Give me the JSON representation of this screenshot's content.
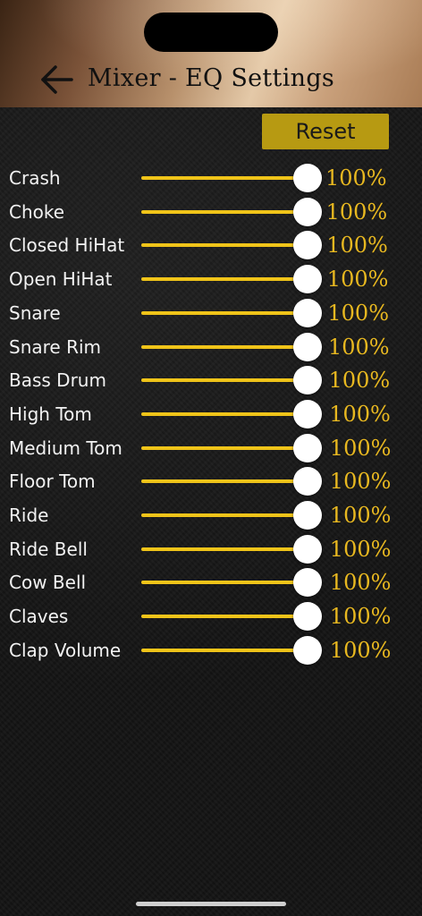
{
  "header": {
    "title": "Mixer - EQ Settings",
    "back_icon": "arrow-left-icon"
  },
  "reset_label": "Reset",
  "colors": {
    "accent": "#f0c419",
    "value_text": "#e8b820",
    "reset_bg": "#b79a12"
  },
  "channels": [
    {
      "label": "Crash",
      "value": "100%",
      "level": 1.0
    },
    {
      "label": "Choke",
      "value": "100%",
      "level": 1.0
    },
    {
      "label": "Closed HiHat",
      "value": "100%",
      "level": 1.0
    },
    {
      "label": "Open HiHat",
      "value": "100%",
      "level": 1.0
    },
    {
      "label": "Snare",
      "value": "100%",
      "level": 1.0
    },
    {
      "label": "Snare Rim",
      "value": "100%",
      "level": 1.0
    },
    {
      "label": "Bass Drum",
      "value": "100%",
      "level": 1.0
    },
    {
      "label": "High Tom",
      "value": "100%",
      "level": 1.0
    },
    {
      "label": "Medium Tom",
      "value": "100%",
      "level": 1.0
    },
    {
      "label": "Floor Tom",
      "value": "100%",
      "level": 1.0
    },
    {
      "label": "Ride",
      "value": "100%",
      "level": 1.0
    },
    {
      "label": "Ride Bell",
      "value": "100%",
      "level": 1.0
    },
    {
      "label": "Cow Bell",
      "value": "100%",
      "level": 1.0
    },
    {
      "label": "Claves",
      "value": "100%",
      "level": 1.0
    },
    {
      "label": "Clap Volume",
      "value": "100%",
      "level": 1.0
    }
  ]
}
